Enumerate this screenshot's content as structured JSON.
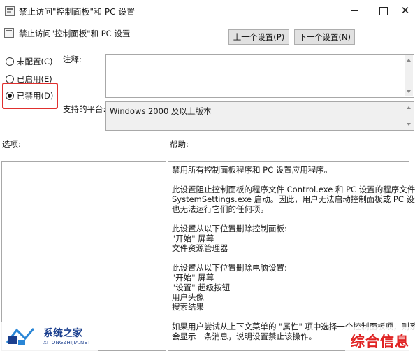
{
  "window": {
    "title": "禁止访问\"控制面板\"和 PC 设置",
    "minimize_glyph": "",
    "maximize_glyph": "",
    "close_glyph": "✕"
  },
  "header": {
    "policy_name": "禁止访问\"控制面板\"和 PC 设置",
    "prev_button": "上一个设置(P)",
    "next_button": "下一个设置(N)"
  },
  "state": {
    "options": [
      {
        "label": "未配置(C)",
        "checked": false
      },
      {
        "label": "已启用(E)",
        "checked": false
      },
      {
        "label": "已禁用(D)",
        "checked": true
      }
    ],
    "highlight_color": "#e0302e"
  },
  "fields": {
    "comment_label": "注释:",
    "comment_value": "",
    "platform_label": "支持的平台:",
    "platform_value": "Windows 2000 及以上版本"
  },
  "sections": {
    "options_label": "选项:",
    "help_label": "帮助:"
  },
  "help_text": [
    "禁用所有控制面板程序和 PC 设置应用程序。",
    "",
    "此设置阻止控制面板的程序文件 Control.exe 和 PC 设置的程序文件",
    "SystemSettings.exe 启动。因此，用户无法启动控制面板或 PC 设置，",
    "也无法运行它们的任何项。",
    "",
    "此设置从以下位置删除控制面板:",
    "\"开始\" 屏幕",
    "文件资源管理器",
    "",
    "此设置从以下位置删除电脑设置:",
    "\"开始\" 屏幕",
    "\"设置\" 超级按钮",
    "用户头像",
    "搜索结果",
    "",
    "如果用户尝试从上下文菜单的 \"属性\" 项中选择一个控制面板项，则系统",
    "会显示一条消息，说明设置禁止该操作。"
  ],
  "watermarks": {
    "left_name": "系统之家",
    "left_sub": "XITONGZHIJIA.NET",
    "right_text": "综合信息",
    "left_color": "#1b3f8e",
    "right_color": "#e02323"
  }
}
